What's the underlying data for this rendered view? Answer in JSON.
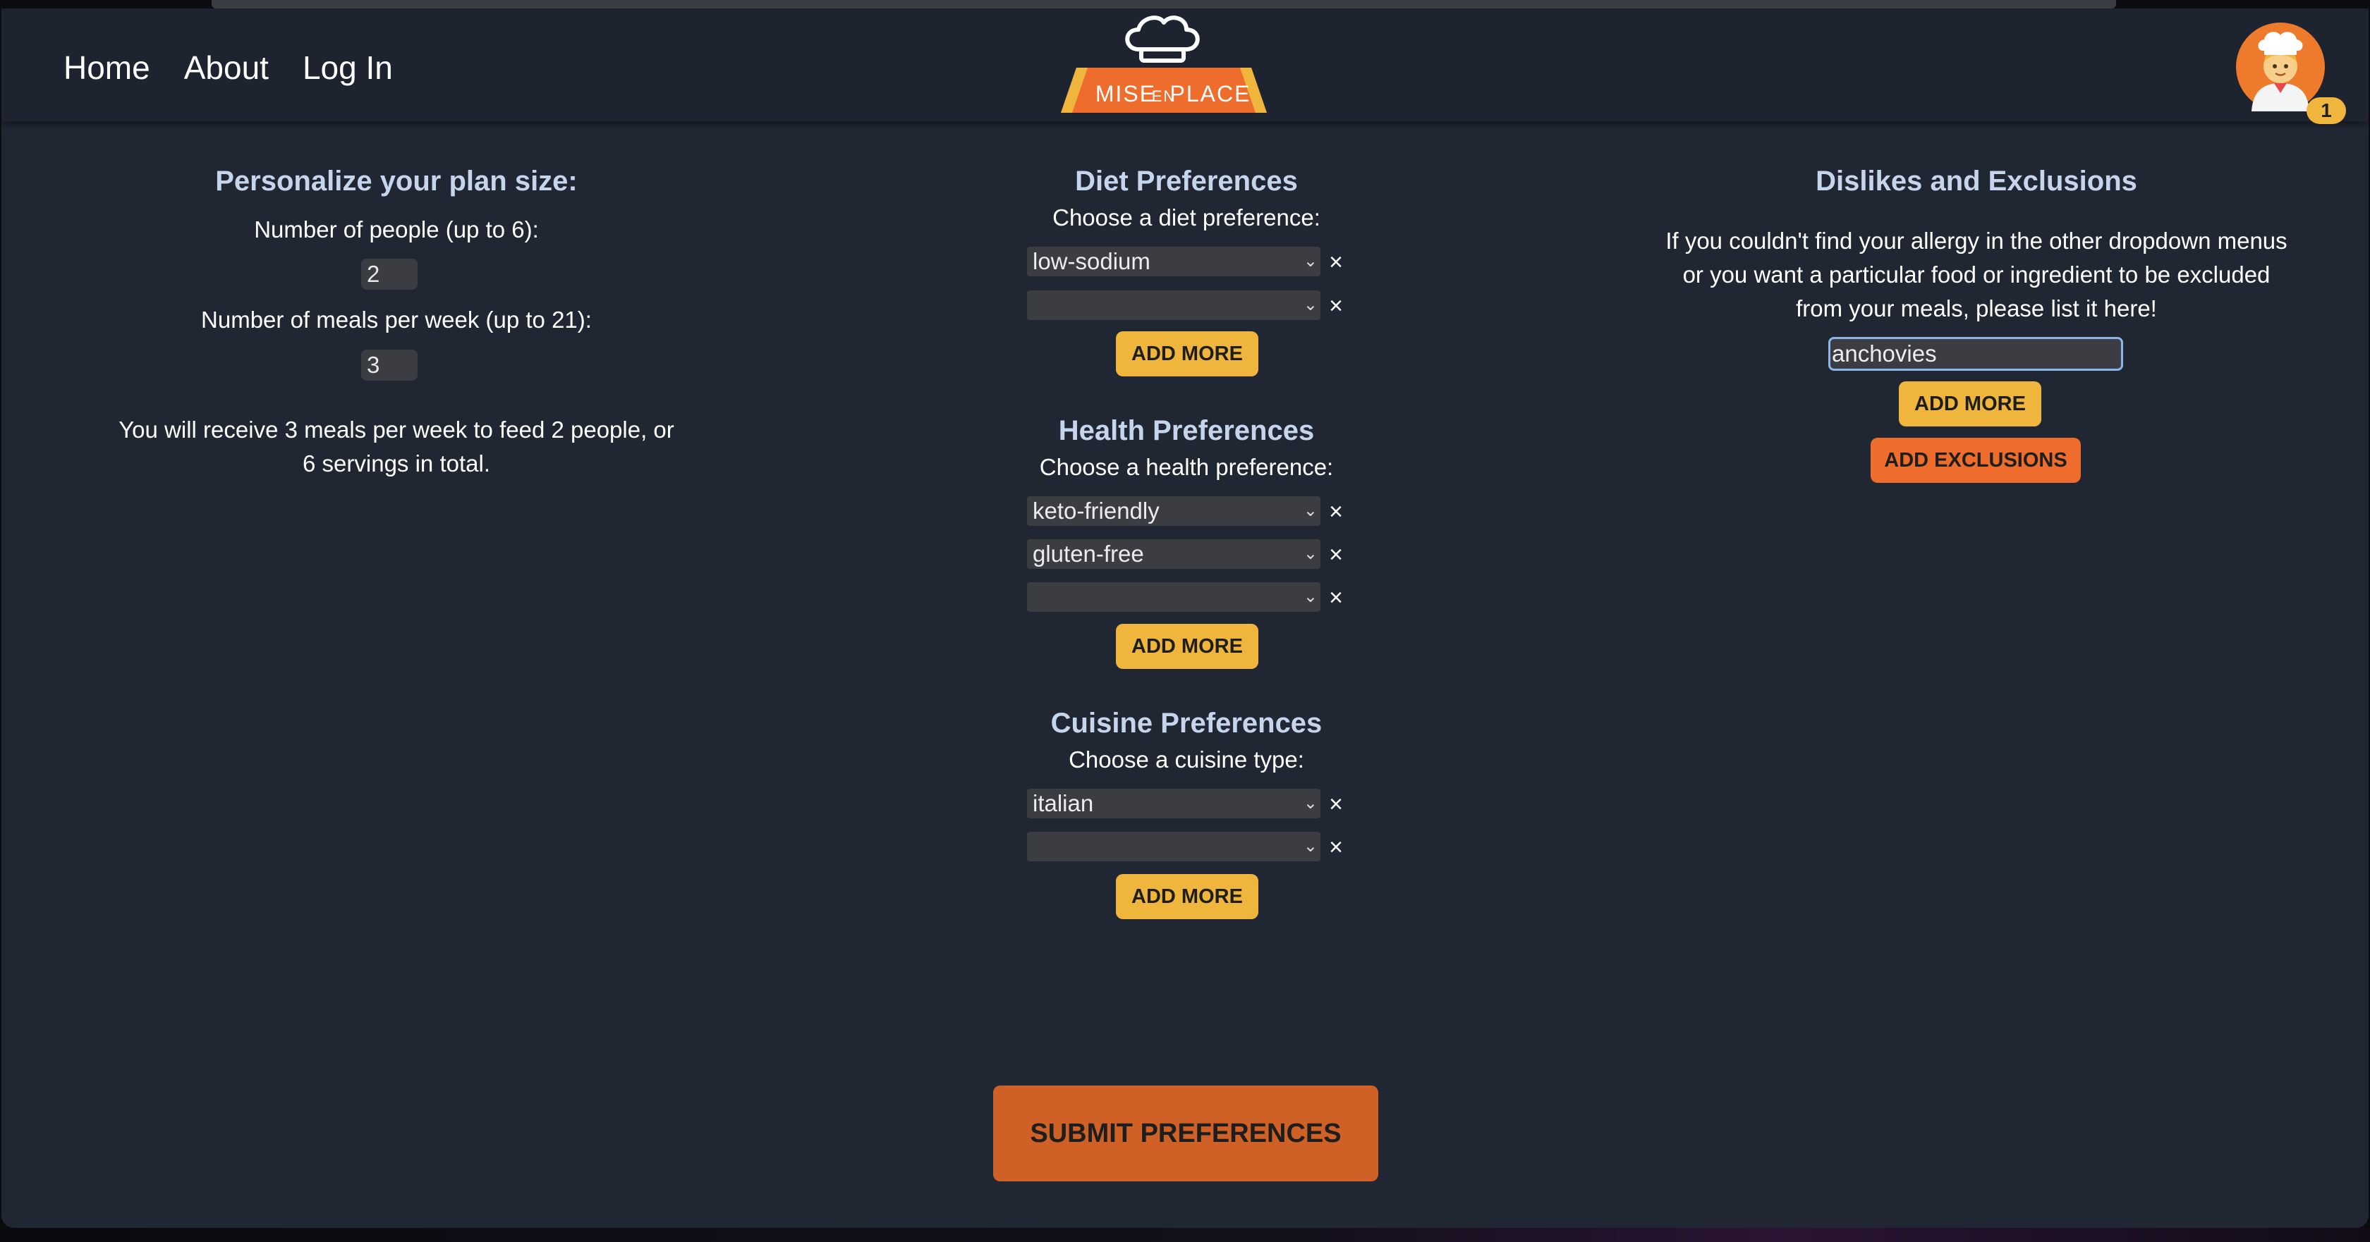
{
  "nav": {
    "links": [
      "Home",
      "About",
      "Log In"
    ],
    "logo_text": {
      "left": "MISE",
      "middle": "EN",
      "right": "PLACE"
    },
    "notification_count": "1"
  },
  "plan": {
    "title": "Personalize your plan size:",
    "people_label": "Number of people (up to 6):",
    "people_value": "2",
    "meals_label": "Number of meals per week (up to 21):",
    "meals_value": "3",
    "summary_line1": "You will receive 3 meals per week to feed 2 people, or",
    "summary_line2": "6 servings in total."
  },
  "diet": {
    "title": "Diet Preferences",
    "prompt": "Choose a diet preference:",
    "selects": [
      "low-sodium",
      ""
    ],
    "add_more": "ADD MORE"
  },
  "health": {
    "title": "Health Preferences",
    "prompt": "Choose a health preference:",
    "selects": [
      "keto-friendly",
      "gluten-free",
      ""
    ],
    "add_more": "ADD MORE"
  },
  "cuisine": {
    "title": "Cuisine Preferences",
    "prompt": "Choose a cuisine type:",
    "selects": [
      "italian",
      ""
    ],
    "add_more": "ADD MORE"
  },
  "exclusions": {
    "title": "Dislikes and Exclusions",
    "desc_line1": "If you couldn't find your allergy in the other dropdown menus",
    "desc_line2": "or you want a particular food or ingredient to be excluded",
    "desc_line3": "from your meals, please list it here!",
    "input_value": "anchovies",
    "add_more": "ADD MORE",
    "add_exclusions": "ADD EXCLUSIONS"
  },
  "submit_label": "SUBMIT PREFERENCES",
  "colors": {
    "background": "#202733",
    "navbar": "#1d242f",
    "accent_yellow": "#f0b53d",
    "accent_orange": "#ee6c2c",
    "submit_orange": "#cf6127",
    "heading": "#c5d5ec"
  },
  "icons": [
    "chef-hat-icon",
    "chef-avatar-icon",
    "chevron-down-icon",
    "close-icon"
  ]
}
